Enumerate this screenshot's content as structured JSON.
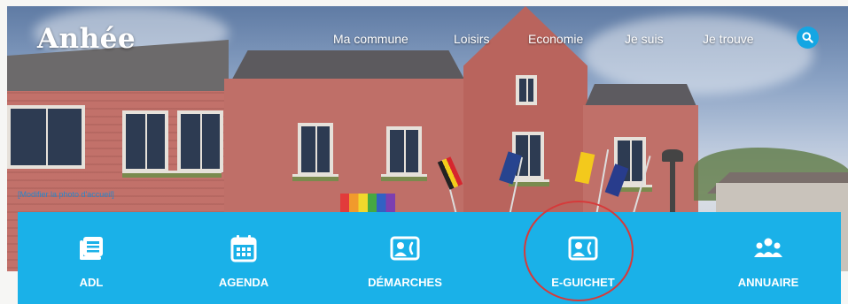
{
  "header": {
    "logo": "Anhée",
    "nav": [
      "Ma commune",
      "Loisirs",
      "Economie",
      "Je suis",
      "Je trouve"
    ],
    "search_icon": "search-icon"
  },
  "hero": {
    "edit_link": "[Modifier la photo d'accueil]"
  },
  "tiles": [
    {
      "label": "ADL",
      "icon": "newspaper-icon"
    },
    {
      "label": "AGENDA",
      "icon": "calendar-icon"
    },
    {
      "label": "DÉMARCHES",
      "icon": "contact-card-icon"
    },
    {
      "label": "E-GUICHET",
      "icon": "contact-card-icon"
    },
    {
      "label": "ANNUAIRE",
      "icon": "group-icon"
    }
  ],
  "colors": {
    "accent": "#1ab1e8",
    "search_button": "#14a6e3",
    "highlight_circle": "#d63a3a"
  }
}
